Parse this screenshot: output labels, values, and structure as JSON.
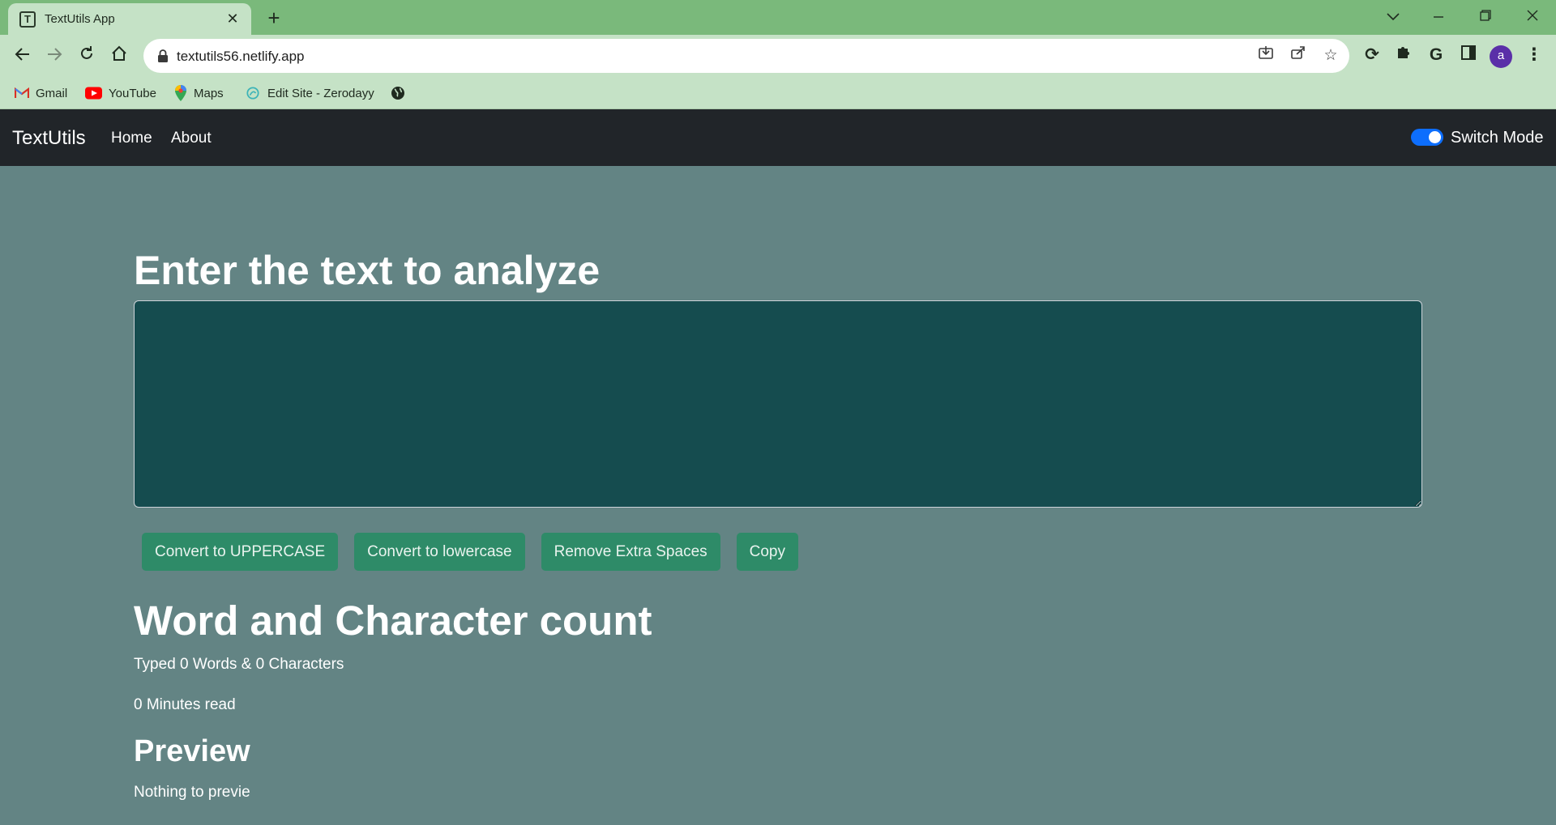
{
  "browser": {
    "tab_title": "TextUtils App",
    "tab_close": "✕",
    "new_tab": "+",
    "url": "textutils56.netlify.app",
    "profile_initial": "a",
    "bookmarks": [
      {
        "label": "Gmail",
        "icon": "gmail-icon"
      },
      {
        "label": "YouTube",
        "icon": "youtube-icon"
      },
      {
        "label": "Maps",
        "icon": "maps-icon"
      },
      {
        "label": "Edit Site - Zerodayy",
        "icon": "site-icon"
      },
      {
        "label": "",
        "icon": "globe-icon"
      }
    ]
  },
  "navbar": {
    "brand": "TextUtils",
    "links": [
      "Home",
      "About"
    ],
    "mode_label": "Switch Mode",
    "mode_enabled": true
  },
  "main": {
    "heading": "Enter the text to analyze",
    "textarea_value": "",
    "buttons": [
      "Convert to UPPERCASE",
      "Convert to lowercase",
      "Remove Extra Spaces",
      "Copy"
    ],
    "summary_heading": "Word and Character count",
    "typed_summary": "Typed 0 Words & 0 Characters",
    "read_time": "0 Minutes read",
    "preview_heading": "Preview",
    "preview_text": "Nothing to previe"
  },
  "colors": {
    "page_bg": "#638484",
    "navbar_bg": "#212529",
    "textarea_bg": "#154c4f",
    "button_bg": "#2e8b68",
    "switch_on": "#0d6efd",
    "chrome_frame": "#7ab97b",
    "chrome_toolbar": "#c5e2c6"
  }
}
